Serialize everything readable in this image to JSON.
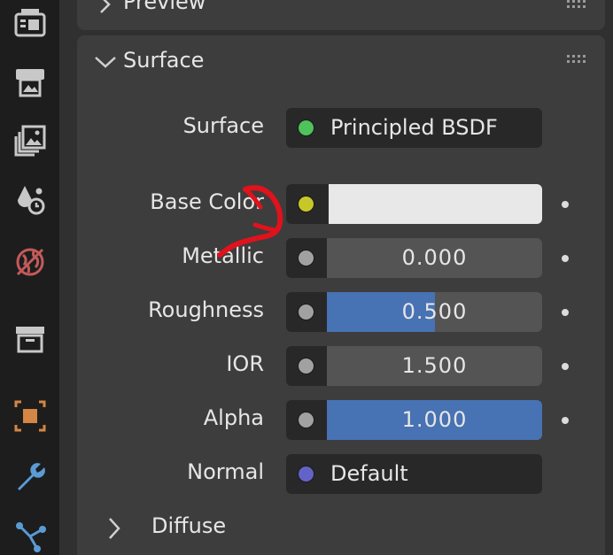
{
  "panels": {
    "preview_title": "Preview",
    "surface_title": "Surface"
  },
  "surface_selector": {
    "label": "Surface",
    "value": "Principled BSDF",
    "socket_color": "#4fc25c"
  },
  "properties": [
    {
      "label": "Base Color",
      "kind": "color",
      "swatch": "#e8e8e8",
      "socket_color": "#c7c729"
    },
    {
      "label": "Metallic",
      "kind": "number",
      "value": "0.000",
      "fraction": 0.0,
      "socket_color": "#a1a1a1"
    },
    {
      "label": "Roughness",
      "kind": "number",
      "value": "0.500",
      "fraction": 0.5,
      "socket_color": "#a1a1a1"
    },
    {
      "label": "IOR",
      "kind": "number",
      "value": "1.500",
      "fraction": 0.0,
      "socket_color": "#a1a1a1"
    },
    {
      "label": "Alpha",
      "kind": "number",
      "value": "1.000",
      "fraction": 1.0,
      "socket_color": "#a1a1a1"
    },
    {
      "label": "Normal",
      "kind": "link",
      "value": "Default",
      "socket_color": "#6363c7"
    }
  ],
  "subpanels": {
    "diffuse_label": "Diffuse"
  },
  "colors": {
    "accent_blue": "#4772b3",
    "annotation_red": "#e0121c"
  },
  "sidebar_icons": [
    "render-icon",
    "output-icon",
    "view-layer-icon",
    "scene-icon",
    "world-icon",
    "collection-icon",
    "object-icon",
    "modifier-wrench-icon",
    "particles-icon"
  ]
}
